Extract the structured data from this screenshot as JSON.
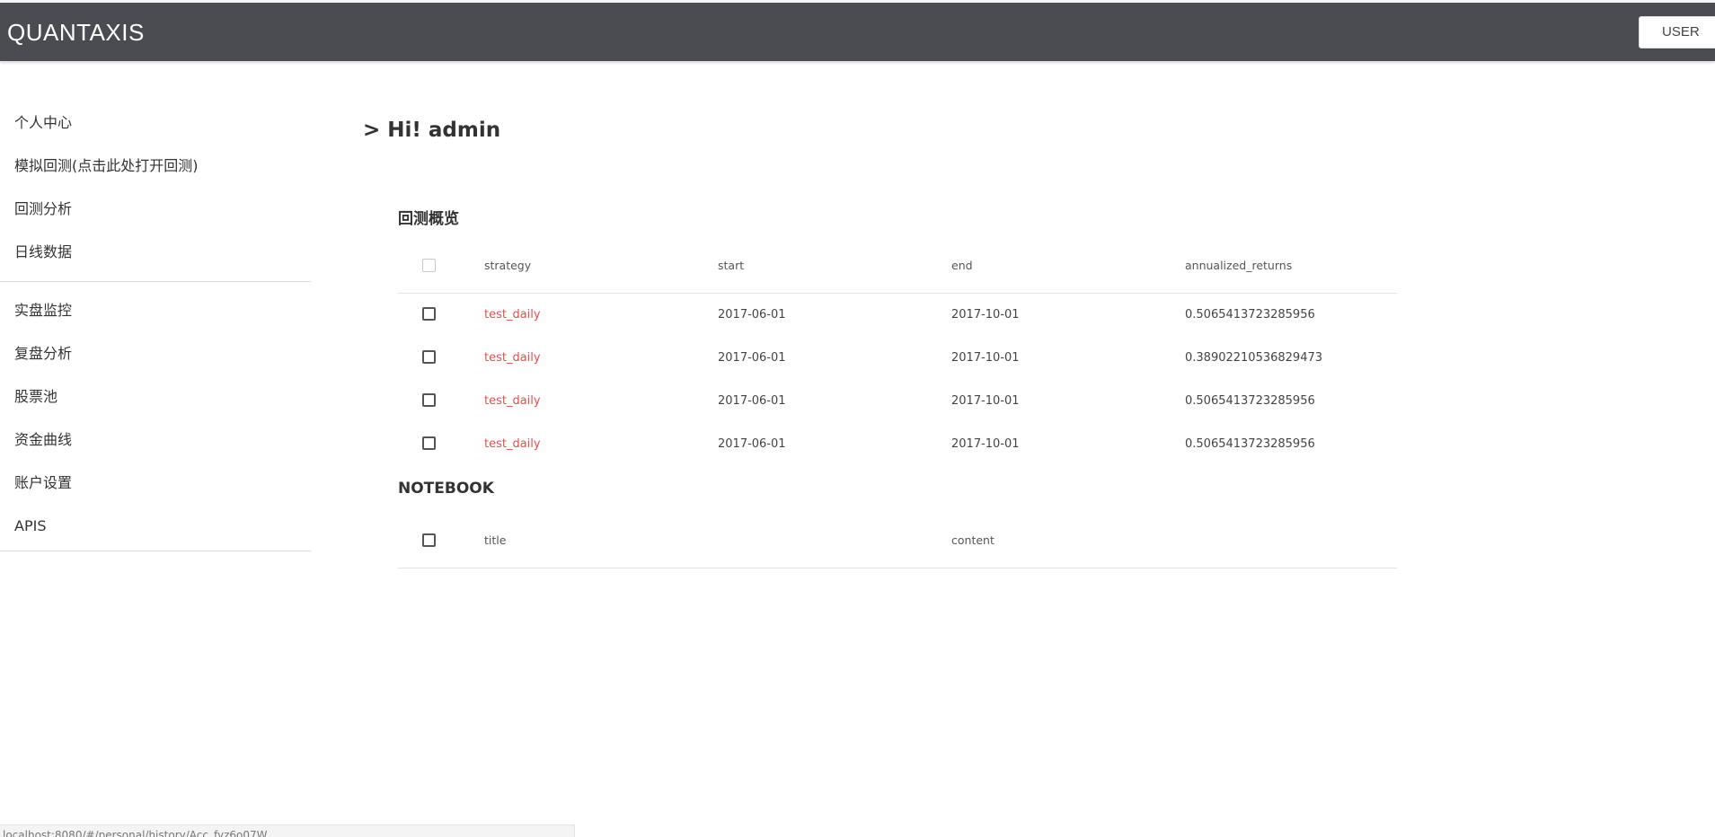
{
  "header": {
    "brand": "QUANTAXIS",
    "user_button": "USER"
  },
  "sidebar": {
    "group1": [
      "个人中心",
      "模拟回测(点击此处打开回测)",
      "回测分析",
      "日线数据"
    ],
    "group2": [
      "实盘监控",
      "复盘分析",
      "股票池",
      "资金曲线",
      "账户设置",
      "APIS"
    ]
  },
  "main": {
    "greeting": "> Hi! admin",
    "backtest": {
      "title": "回测概览",
      "columns": [
        "strategy",
        "start",
        "end",
        "annualized_returns"
      ],
      "rows": [
        {
          "strategy": "test_daily",
          "start": "2017-06-01",
          "end": "2017-10-01",
          "annualized_returns": "0.5065413723285956"
        },
        {
          "strategy": "test_daily",
          "start": "2017-06-01",
          "end": "2017-10-01",
          "annualized_returns": "0.38902210536829473"
        },
        {
          "strategy": "test_daily",
          "start": "2017-06-01",
          "end": "2017-10-01",
          "annualized_returns": "0.5065413723285956"
        },
        {
          "strategy": "test_daily",
          "start": "2017-06-01",
          "end": "2017-10-01",
          "annualized_returns": "0.5065413723285956"
        }
      ]
    },
    "notebook": {
      "title": "NOTEBOOK",
      "columns": [
        "title",
        "content"
      ]
    }
  },
  "status_url": "localhost:8080/#/personal/history/Acc_fyz6o07W"
}
